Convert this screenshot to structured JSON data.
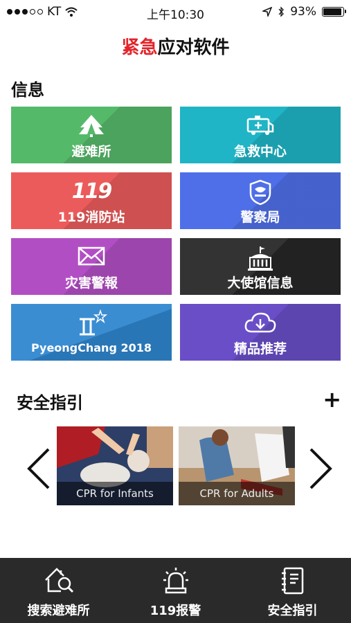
{
  "status": {
    "carrier": "KT",
    "time": "上午10:30",
    "battery": "93%"
  },
  "app": {
    "title_red": "紧急",
    "title_black": "应对软件"
  },
  "info": {
    "heading": "信息",
    "tiles": [
      {
        "label": "避难所",
        "icon": "shelter-icon",
        "color": "#55b96a"
      },
      {
        "label": "急救中心",
        "icon": "ambulance-icon",
        "color": "#1fb5c6"
      },
      {
        "label": "119消防站",
        "icon": "fire-119-logo",
        "logo_text": "119",
        "color": "#ec5b5b"
      },
      {
        "label": "警察局",
        "icon": "police-badge-icon",
        "color": "#4f6fe8"
      },
      {
        "label": "灾害警報",
        "icon": "envelope-icon",
        "color": "#b24ec4"
      },
      {
        "label": "大使馆信息",
        "icon": "embassy-building-icon",
        "color": "#2b2b2b"
      },
      {
        "label": "PyeongChang 2018",
        "icon": "pyeongchang-logo",
        "color": "#2f86cf"
      },
      {
        "label": "精品推荐",
        "icon": "cloud-download-icon",
        "color": "#6a4ec8"
      }
    ]
  },
  "guide": {
    "heading": "安全指引",
    "cards": [
      {
        "caption": "CPR for Infants"
      },
      {
        "caption": "CPR for Adults"
      }
    ]
  },
  "tabbar": {
    "tabs": [
      {
        "label": "搜索避难所",
        "icon": "house-search-icon"
      },
      {
        "label": "119报警",
        "icon": "siren-icon"
      },
      {
        "label": "安全指引",
        "icon": "guidebook-icon"
      }
    ]
  }
}
